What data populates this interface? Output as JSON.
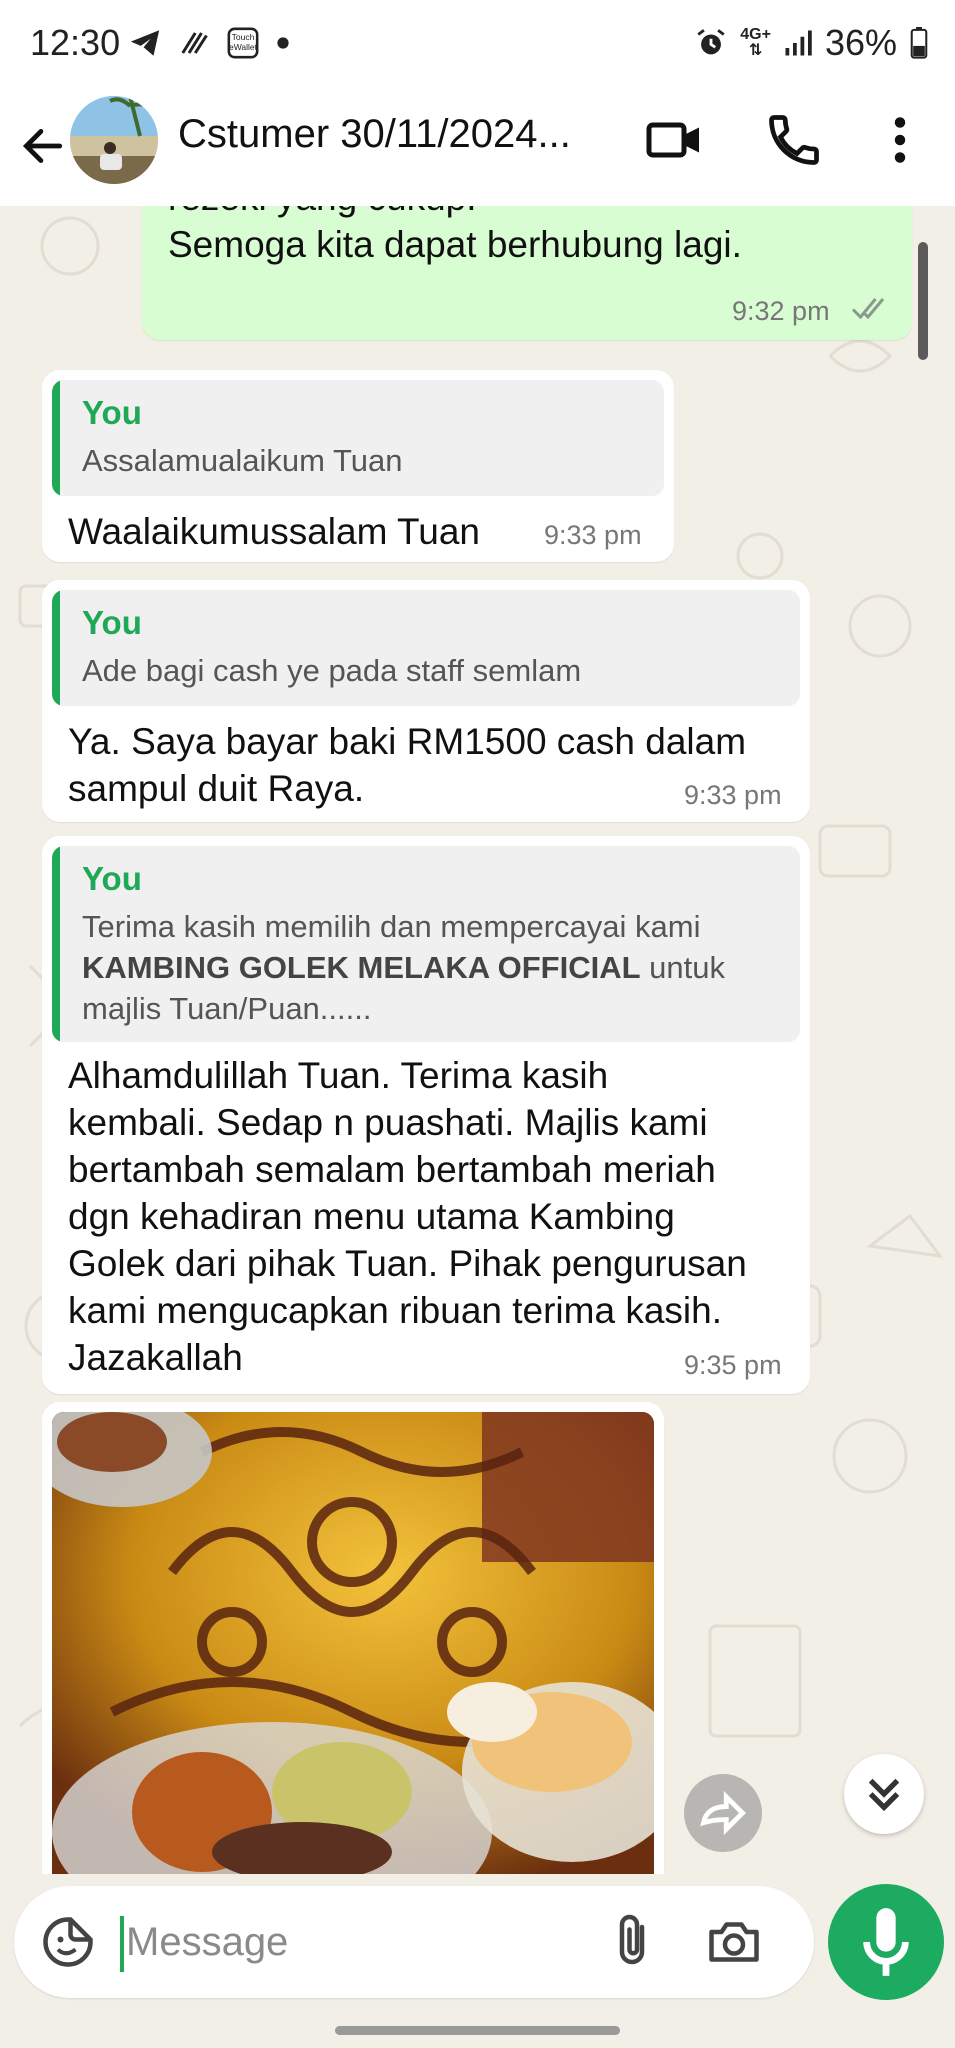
{
  "status_bar": {
    "time": "12:30",
    "network": "4G+",
    "battery": "36%",
    "icons": [
      "telegram-icon",
      "touchngo-icon",
      "wallet-icon",
      "dot-icon",
      "alarm-icon",
      "signal-icon",
      "battery-icon"
    ]
  },
  "header": {
    "title": "Cstumer 30/11/2024...",
    "icons": [
      "back-arrow-icon",
      "video-call-icon",
      "voice-call-icon",
      "more-vert-icon"
    ]
  },
  "messages": [
    {
      "type": "outgoing",
      "text_partial": "rezeki yang cukup.",
      "text": "Semoga kita dapat berhubung lagi.",
      "time": "9:32 pm",
      "status": "read"
    },
    {
      "type": "incoming",
      "quote_author": "You",
      "quote_text": "Assalamualaikum Tuan",
      "text": "Waalaikumussalam Tuan",
      "time": "9:33 pm"
    },
    {
      "type": "incoming",
      "quote_author": "You",
      "quote_text": "Ade bagi cash ye pada staff semlam",
      "text": "Ya. Saya bayar baki RM1500 cash dalam\nsampul duit Raya.",
      "time": "9:33 pm"
    },
    {
      "type": "incoming",
      "quote_author": "You",
      "quote_text_1": "Terima kasih memilih dan mempercayai kami",
      "quote_text_bold": "KAMBING GOLEK MELAKA OFFICIAL",
      "quote_text_2": " untuk",
      "quote_text_3": "majlis Tuan/Puan......",
      "text": "Alhamdulillah Tuan. Terima kasih\nkembali. Sedap n puashati. Majlis kami\nbertambah semalam bertambah meriah\ndgn kehadiran menu utama Kambing\nGolek dari pihak Tuan. Pihak pengurusan\nkami mengucapkan ribuan terima kasih.\nJazakallah",
      "time": "9:35 pm"
    }
  ],
  "composer": {
    "placeholder": "Message"
  },
  "colors": {
    "accent": "#1fa855",
    "outgoing_bubble": "#d8fdd2",
    "chat_background": "#f2efe7",
    "mic_button": "#1daa61"
  }
}
